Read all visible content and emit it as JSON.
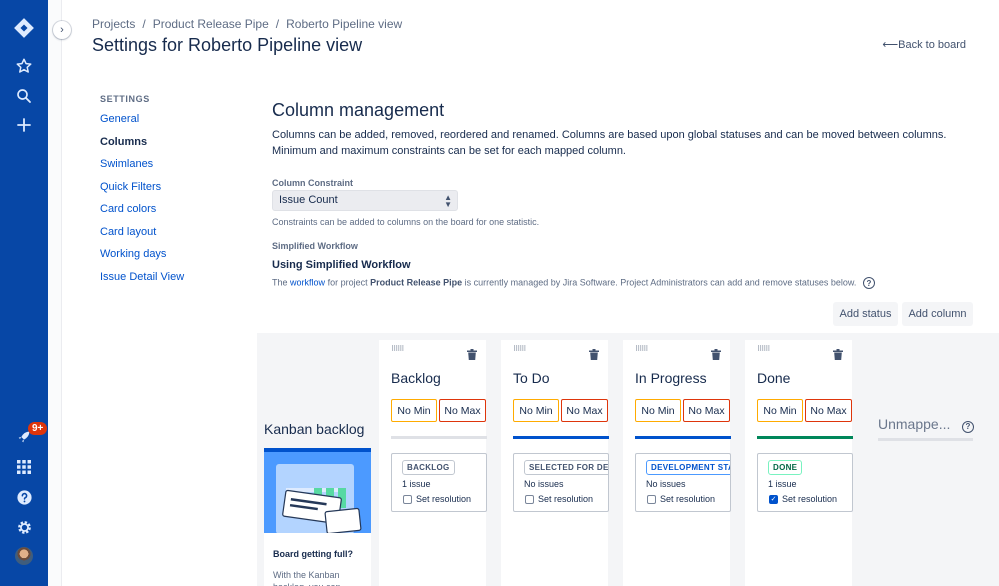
{
  "breadcrumb": {
    "items": [
      "Projects",
      "Product Release Pipe",
      "Roberto Pipeline view"
    ],
    "separator": "/"
  },
  "page_title": "Settings for Roberto Pipeline view",
  "back_link": "Back to board",
  "global_nav": {
    "notification_badge": "9+",
    "icons": [
      "jira-logo-icon",
      "star-icon",
      "search-icon",
      "create-icon",
      "rocket-icon",
      "app-switcher-icon",
      "help-icon",
      "settings-icon",
      "avatar"
    ]
  },
  "settings_nav": {
    "title": "SETTINGS",
    "items": [
      {
        "label": "General",
        "active": false
      },
      {
        "label": "Columns",
        "active": true
      },
      {
        "label": "Swimlanes",
        "active": false
      },
      {
        "label": "Quick Filters",
        "active": false
      },
      {
        "label": "Card colors",
        "active": false
      },
      {
        "label": "Card layout",
        "active": false
      },
      {
        "label": "Working days",
        "active": false
      },
      {
        "label": "Issue Detail View",
        "active": false
      }
    ]
  },
  "column_management": {
    "heading": "Column management",
    "description": "Columns can be added, removed, reordered and renamed. Columns are based upon global statuses and can be moved between columns. Minimum and maximum constraints can be set for each mapped column.",
    "constraint_label": "Column Constraint",
    "constraint_value": "Issue Count",
    "constraint_hint": "Constraints can be added to columns on the board for one statistic.",
    "workflow_label": "Simplified Workflow",
    "workflow_title": "Using Simplified Workflow",
    "workflow_text_1": "The",
    "workflow_link": "workflow",
    "workflow_text_2": "for project",
    "workflow_project": "Product Release Pipe",
    "workflow_text_3": "is currently managed by Jira Software. Project Administrators can add and remove statuses below.",
    "add_status": "Add status",
    "add_column": "Add column"
  },
  "kanban_backlog": {
    "title": "Kanban backlog",
    "card_heading": "Board getting full?",
    "card_text": "With the Kanban backlog, you can"
  },
  "columns": [
    {
      "name": "Backlog",
      "min": "No Min",
      "max": "No Max",
      "bar_color": "#DFE1E6",
      "status": "BACKLOG",
      "status_color": "#42526E",
      "status_border": "#C1C7D0",
      "count": "1 issue",
      "resolution": "Set resolution",
      "checked": false
    },
    {
      "name": "To Do",
      "min": "No Min",
      "max": "No Max",
      "bar_color": "#0052CC",
      "status": "SELECTED FOR DEVELOPMENT",
      "status_color": "#42526E",
      "status_border": "#C1C7D0",
      "count": "No issues",
      "resolution": "Set resolution",
      "checked": false
    },
    {
      "name": "In Progress",
      "min": "No Min",
      "max": "No Max",
      "bar_color": "#0052CC",
      "status": "DEVELOPMENT STARTED",
      "status_color": "#0052CC",
      "status_border": "#4C9AFF",
      "count": "No issues",
      "resolution": "Set resolution",
      "checked": false
    },
    {
      "name": "Done",
      "min": "No Min",
      "max": "No Max",
      "bar_color": "#00875A",
      "status": "DONE",
      "status_color": "#006644",
      "status_border": "#79F2C0",
      "count": "1 issue",
      "resolution": "Set resolution",
      "checked": true
    }
  ],
  "unmapped": {
    "title": "Unmappe..."
  }
}
